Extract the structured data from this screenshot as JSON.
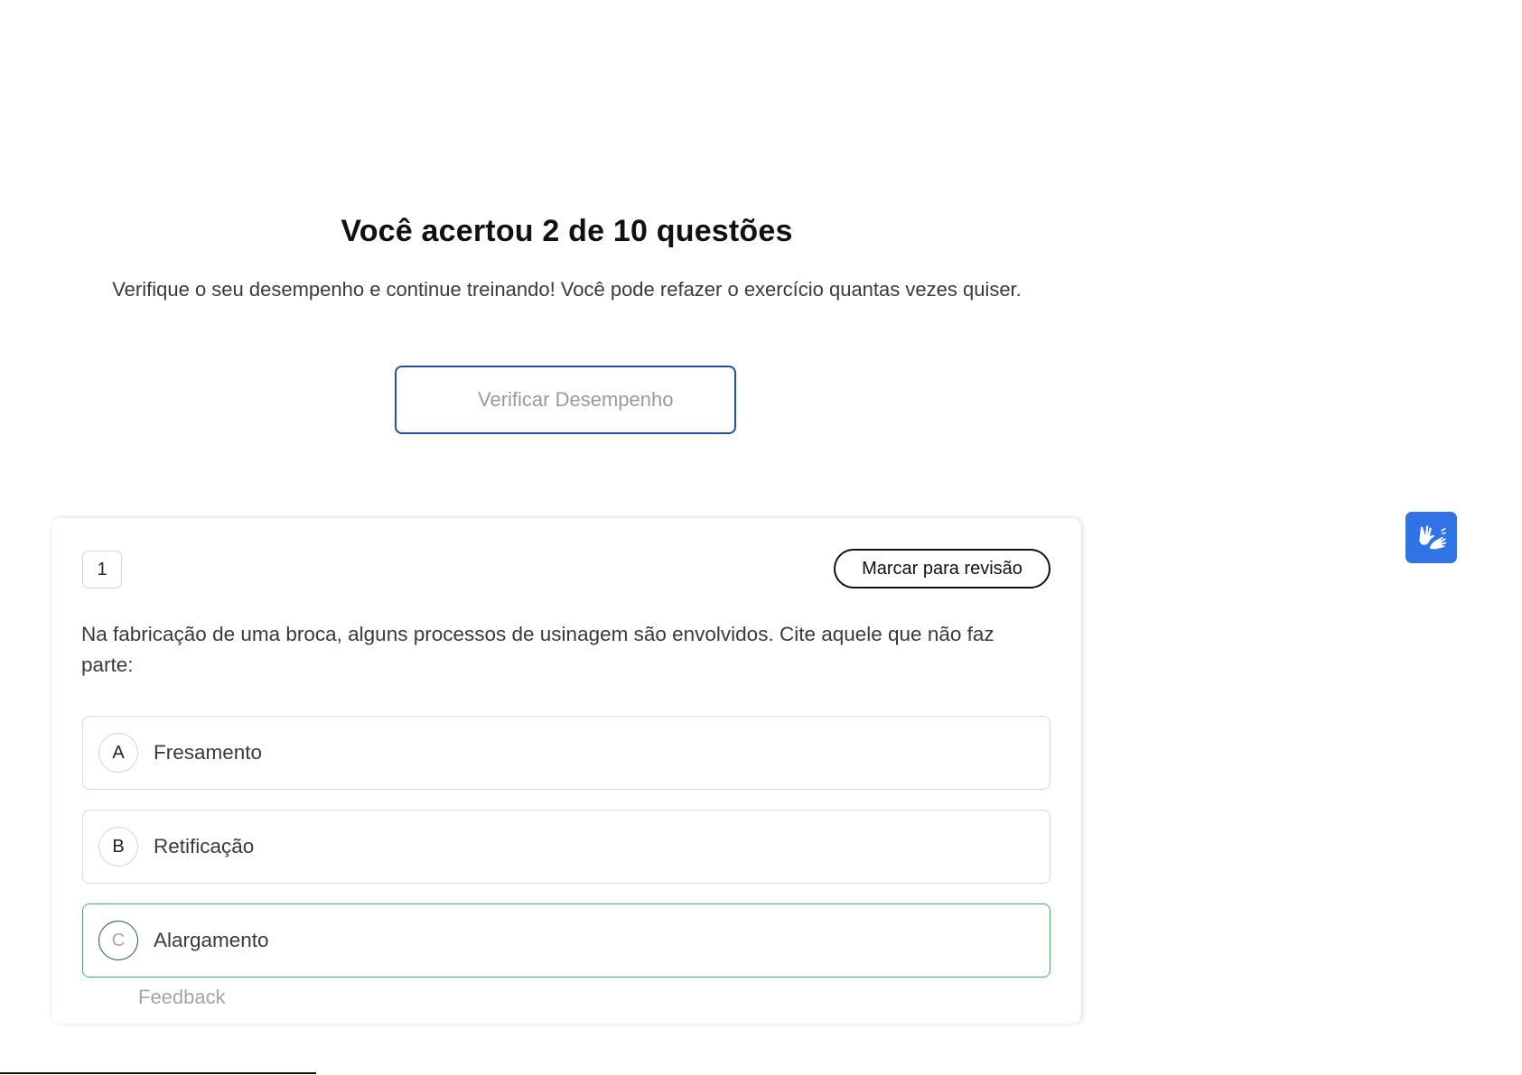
{
  "result": {
    "title": "Você acertou 2 de 10 questões",
    "subtitle": "Verifique o seu desempenho e continue treinando! Você pode refazer o exercício quantas vezes quiser.",
    "verify_button_label": "Verificar Desempenho",
    "accent_color": "#1d4cc7"
  },
  "question": {
    "number": "1",
    "review_button_label": "Marcar para revisão",
    "text": "Na fabricação de uma broca, alguns processos de usinagem são envolvidos. Cite aquele que não faz parte:",
    "options": [
      {
        "letter": "A",
        "label": "Fresamento",
        "state": "default"
      },
      {
        "letter": "B",
        "label": "Retificação",
        "state": "default"
      },
      {
        "letter": "C",
        "label": "Alargamento",
        "state": "correct"
      }
    ],
    "feedback_label": "Feedback",
    "correct_color": "#3dbb50"
  },
  "accessibility": {
    "libras_icon": "sign-language-hands-icon",
    "libras_color": "#2f73e6"
  }
}
